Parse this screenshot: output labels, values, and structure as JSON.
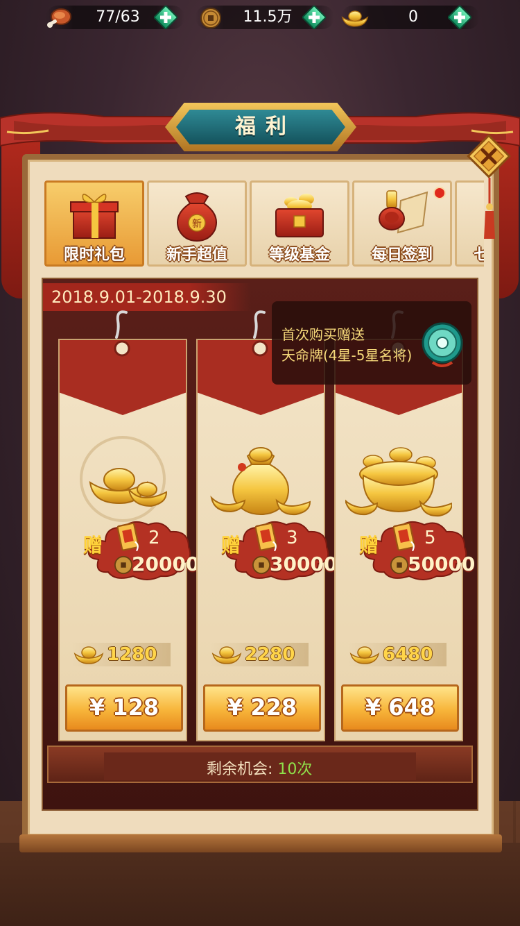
{
  "resources": [
    {
      "icon": "meat-icon",
      "value": "77/63"
    },
    {
      "icon": "copper-coin-icon",
      "value": "11.5万"
    },
    {
      "icon": "gold-ingot-icon",
      "value": "0"
    }
  ],
  "window": {
    "title": "福利"
  },
  "tabs": [
    {
      "label": "限时礼包",
      "icon": "gift-box-icon",
      "active": true
    },
    {
      "label": "新手超值",
      "icon": "red-pouch-icon",
      "active": false
    },
    {
      "label": "等级基金",
      "icon": "treasure-chest-icon",
      "active": false
    },
    {
      "label": "每日签到",
      "icon": "seal-stamp-icon",
      "active": false,
      "badge": true
    },
    {
      "label": "七",
      "icon": "",
      "active": false
    }
  ],
  "promo": {
    "date_range": "2018.9.01-2018.9.30",
    "tooltip_line1": "首次购买赠送",
    "tooltip_line2": "天命牌(4星-5星名将)"
  },
  "packages": [
    {
      "gift_word": "赠",
      "card_count": "2",
      "coin_bonus": "20000",
      "gold": "1280",
      "price": "¥ 128"
    },
    {
      "gift_word": "赠",
      "card_count": "3",
      "coin_bonus": "30000",
      "gold": "2280",
      "price": "¥ 228"
    },
    {
      "gift_word": "赠",
      "card_count": "5",
      "coin_bonus": "50000",
      "gold": "6480",
      "price": "¥ 648"
    }
  ],
  "remaining": {
    "label": "剩余机会:",
    "count": "10次"
  },
  "colors": {
    "accent_gold": "#f7b53a",
    "banner_red": "#a92d21",
    "count_green": "#8fe04a"
  }
}
